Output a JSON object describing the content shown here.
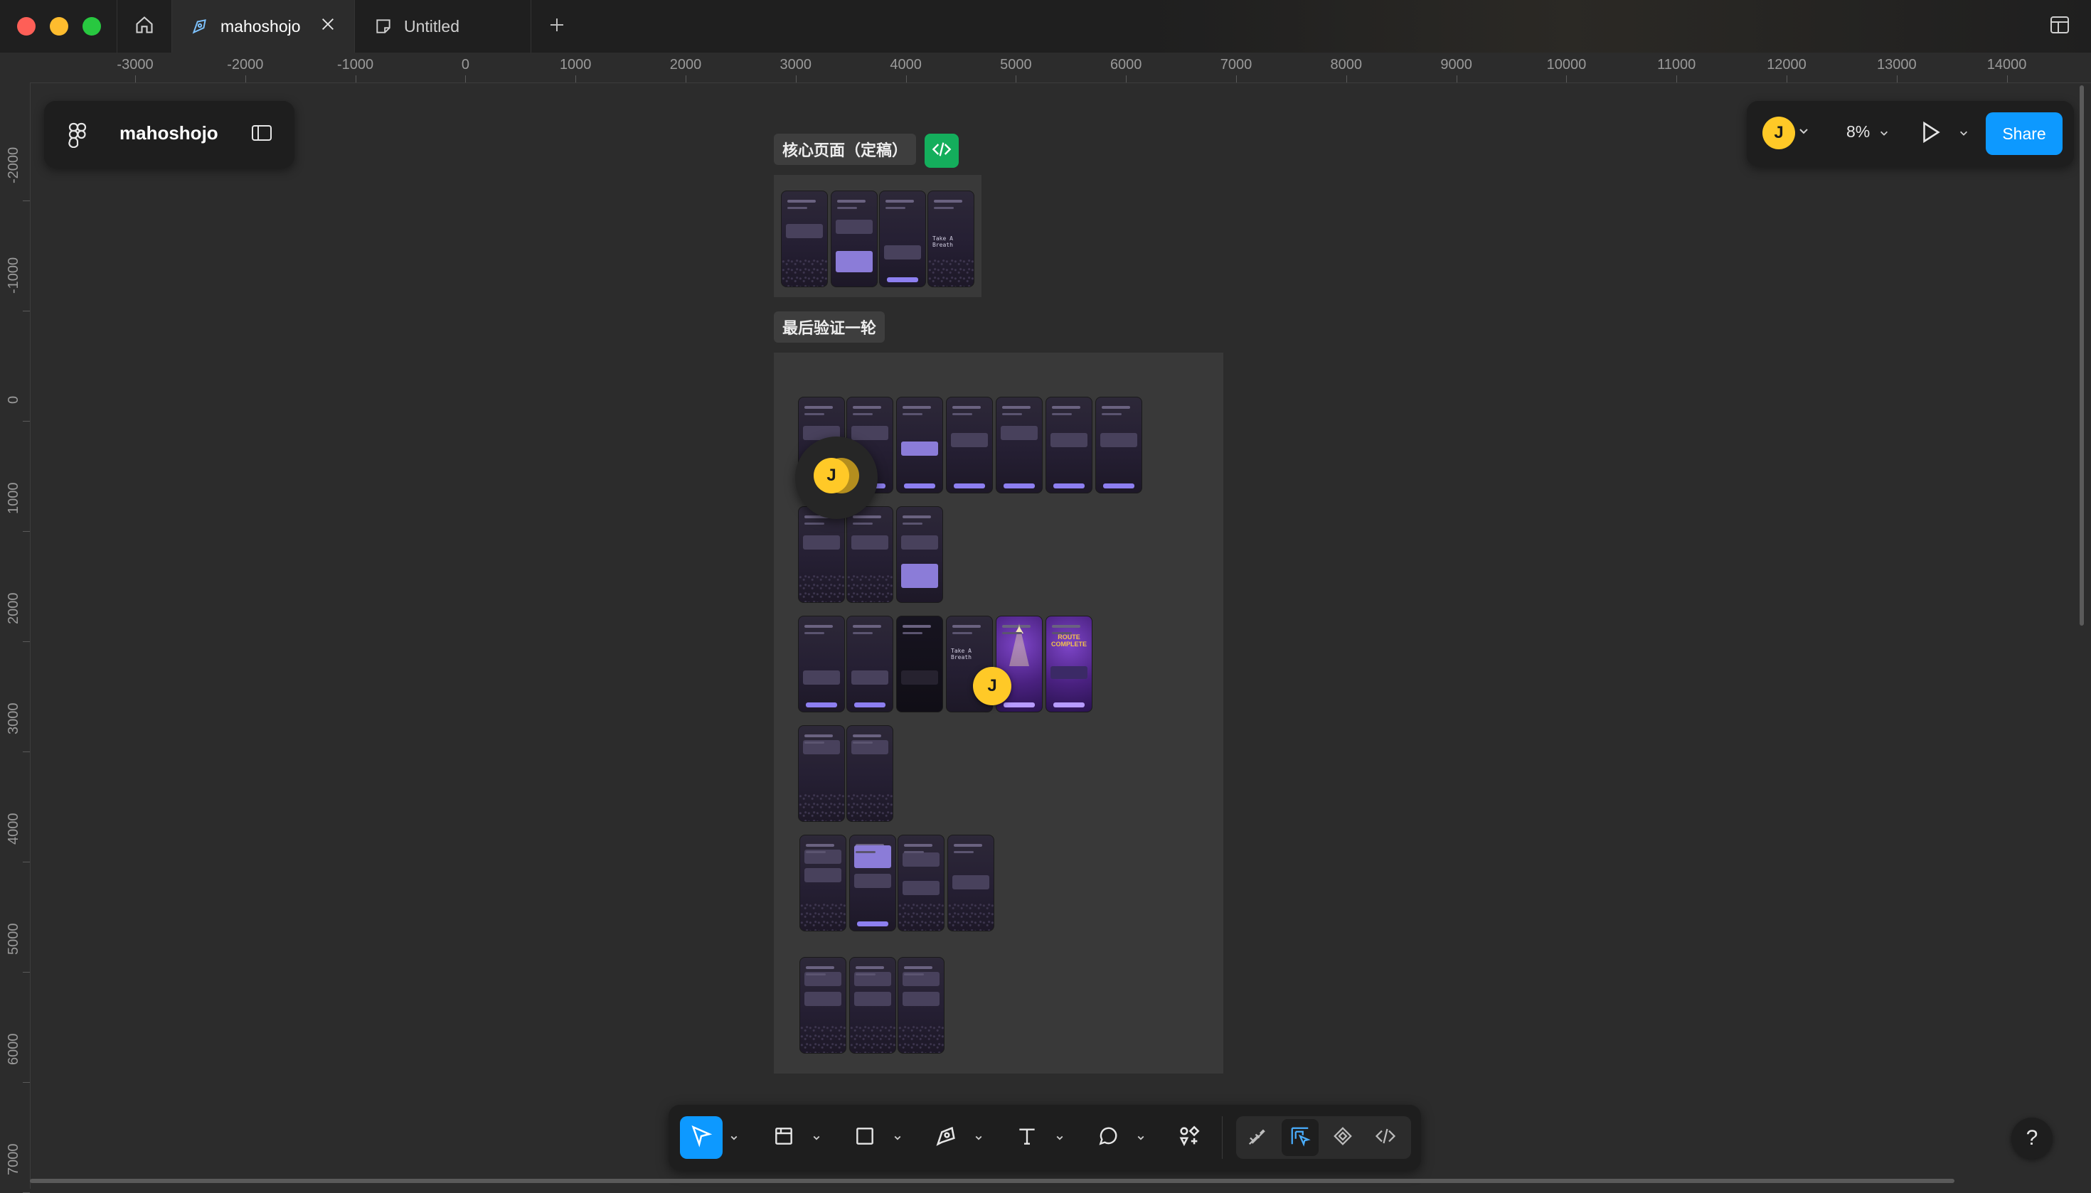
{
  "window": {
    "tabs": [
      {
        "label": "mahoshojo",
        "active": true,
        "icon": "design-file-icon"
      },
      {
        "label": "Untitled",
        "active": false,
        "icon": "figjam-file-icon"
      }
    ]
  },
  "ruler": {
    "top_labels": [
      "-3000",
      "-2000",
      "-1000",
      "0",
      "1000",
      "2000",
      "3000",
      "4000",
      "5000",
      "6000",
      "7000",
      "8000",
      "9000",
      "10000",
      "11000",
      "12000",
      "13000",
      "14000"
    ],
    "left_labels": [
      "-2000",
      "-1000",
      "0",
      "1000",
      "2000",
      "3000",
      "4000",
      "5000",
      "6000",
      "7000"
    ]
  },
  "file_panel": {
    "file_name": "mahoshojo"
  },
  "top_right": {
    "avatar_initial": "J",
    "zoom": "8%",
    "share_label": "Share"
  },
  "canvas": {
    "section1": {
      "label": "核心页面（定稿）"
    },
    "section2": {
      "label": "最后验证一轮"
    },
    "screen_texts": {
      "take_a_breath": "Take A Breath",
      "route_complete": "ROUTE COMPLETE"
    },
    "cursor_initial": "J"
  },
  "toolbar": {
    "tools": [
      "move-tool",
      "frame-tool",
      "shape-tool",
      "pen-tool",
      "text-tool",
      "comment-tool",
      "actions-tool"
    ],
    "modes": [
      "draw-mode",
      "design-mode",
      "prototype-mode",
      "dev-mode"
    ],
    "active_tool": "move-tool",
    "active_mode": "design-mode"
  },
  "help_label": "?",
  "colors": {
    "accent": "#0d99ff",
    "dev_green": "#14ae5c",
    "avatar": "#ffc927"
  }
}
